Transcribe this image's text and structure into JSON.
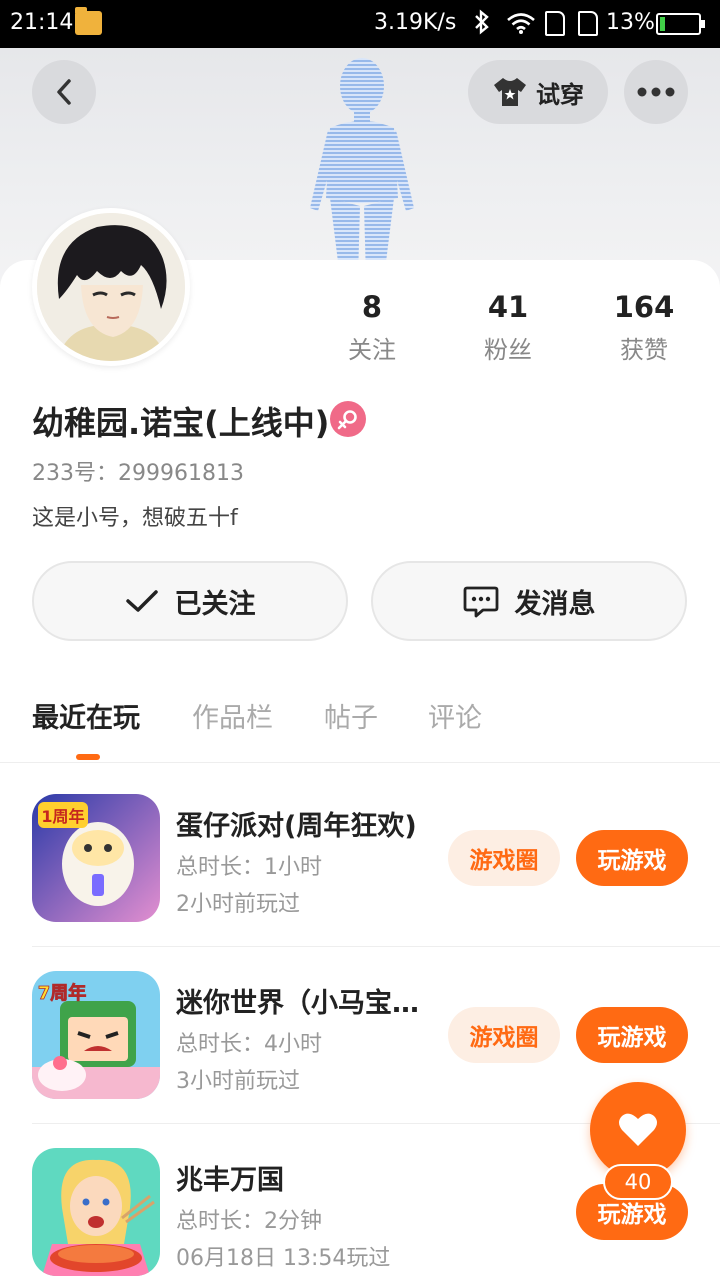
{
  "status_bar": {
    "time": "21:14",
    "network_speed": "3.19K/s",
    "battery_percent": "13%",
    "battery_level": 0.13,
    "icons": [
      "folder-icon",
      "bluetooth-icon",
      "wifi-icon",
      "sim-icon",
      "sim-icon",
      "battery-icon"
    ]
  },
  "header": {
    "try_on_label": "试穿",
    "icons": [
      "back-arrow-icon",
      "tshirt-icon",
      "more-dots-icon"
    ]
  },
  "stats": [
    {
      "value": "8",
      "label": "关注"
    },
    {
      "value": "41",
      "label": "粉丝"
    },
    {
      "value": "164",
      "label": "获赞"
    }
  ],
  "profile": {
    "username": "幼稚园.诺宝(上线中)",
    "gender_icon": "female-icon",
    "uid": "233号：299961813",
    "bio": "这是小号，想破五十f"
  },
  "actions": {
    "follow_label": "已关注",
    "message_label": "发消息"
  },
  "tabs": [
    {
      "label": "最近在玩",
      "active": true
    },
    {
      "label": "作品栏",
      "active": false
    },
    {
      "label": "帖子",
      "active": false
    },
    {
      "label": "评论",
      "active": false
    }
  ],
  "games": [
    {
      "title": "蛋仔派对(周年狂欢)",
      "duration": "总时长：1小时",
      "last_played": "2小时前玩过",
      "circle_label": "游戏圈",
      "play_label": "玩游戏",
      "icon_badge": "1周年"
    },
    {
      "title": "迷你世界（小马宝莉联动）",
      "duration": "总时长：4小时",
      "last_played": "3小时前玩过",
      "circle_label": "游戏圈",
      "play_label": "玩游戏",
      "icon_badge": "7周年"
    },
    {
      "title": "兆丰万国",
      "duration": "总时长：2分钟",
      "last_played": "06月18日 13:54玩过",
      "play_label": "玩游戏"
    }
  ],
  "like": {
    "count": "40",
    "icon": "heart-icon"
  },
  "colors": {
    "accent": "#ff6a13",
    "accent_light": "#fdeee3",
    "gender": "#f06a88"
  }
}
